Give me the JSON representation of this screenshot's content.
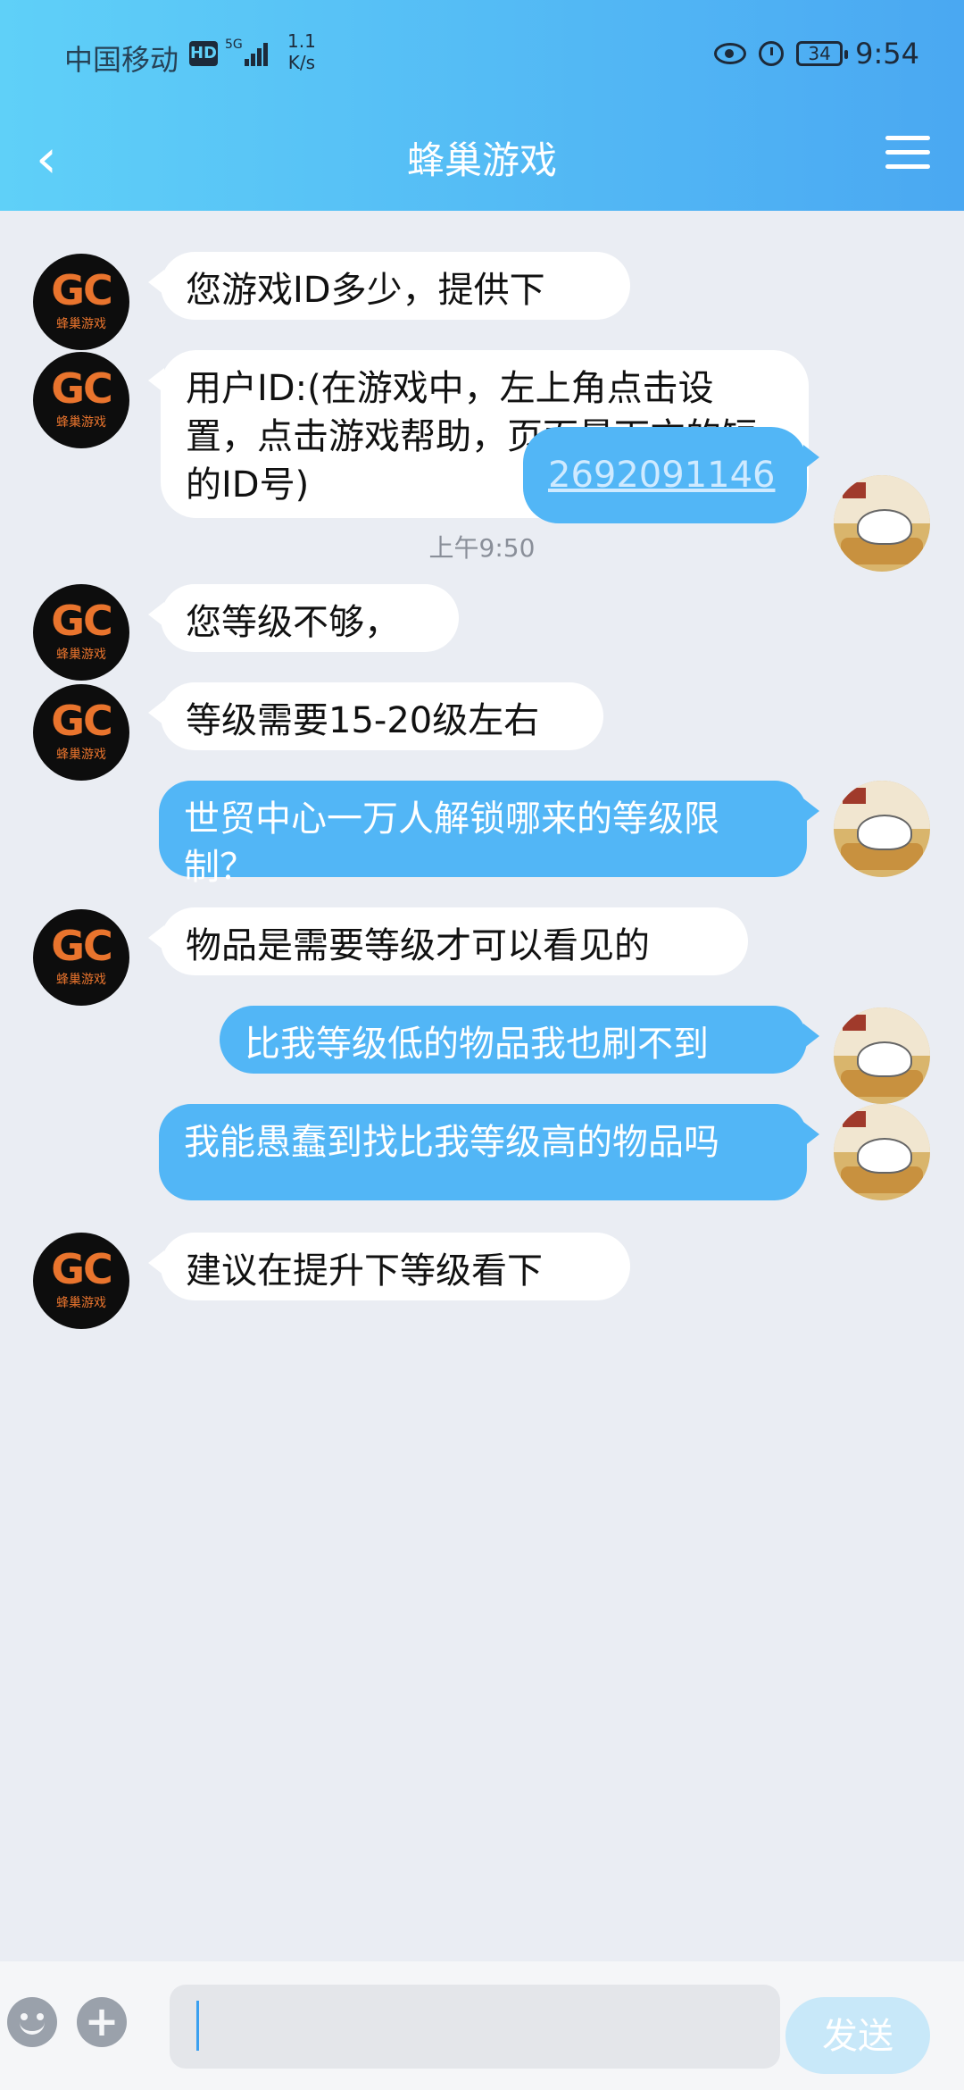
{
  "status_bar": {
    "carrier": "中国移动",
    "hd_badge": "HD",
    "network": "5G",
    "speed_value": "1.1",
    "speed_unit": "K/s",
    "battery": "34",
    "time": "9:54"
  },
  "header": {
    "title": "蜂巢游戏",
    "back_icon": "chevron-left-icon",
    "menu_icon": "hamburger-menu-icon"
  },
  "avatars": {
    "gc_text": "GC",
    "gc_sub": "蜂巢游戏"
  },
  "messages": [
    {
      "side": "left",
      "text": "您游戏ID多少，提供下"
    },
    {
      "side": "left",
      "text": "用户ID:(在游戏中，左上角点击设置，点击游戏帮助，页面最下方的短的ID号)"
    },
    {
      "side": "right",
      "text": "2692091146",
      "is_link": true
    },
    {
      "timestamp": "上午9:50"
    },
    {
      "side": "left",
      "text": "您等级不够，"
    },
    {
      "side": "left",
      "text": "等级需要15-20级左右"
    },
    {
      "side": "right",
      "text": "世贸中心一万人解锁哪来的等级限制？"
    },
    {
      "side": "left",
      "text": "物品是需要等级才可以看见的"
    },
    {
      "side": "right",
      "text": "比我等级低的物品我也刷不到"
    },
    {
      "side": "right",
      "text": "我能愚蠢到找比我等级高的物品吗"
    },
    {
      "side": "left",
      "text": "建议在提升下等级看下"
    }
  ],
  "input_bar": {
    "emoji_icon": "emoji-icon",
    "plus_icon": "plus-icon",
    "input_value": "",
    "send_label": "发送"
  },
  "colors": {
    "header_gradient_start": "#5fd0f8",
    "header_gradient_end": "#4aa8f2",
    "outgoing_bubble": "#52b6f6",
    "incoming_bubble": "#ffffff",
    "background": "#eaedf3",
    "send_button": "#c8e8f9"
  }
}
